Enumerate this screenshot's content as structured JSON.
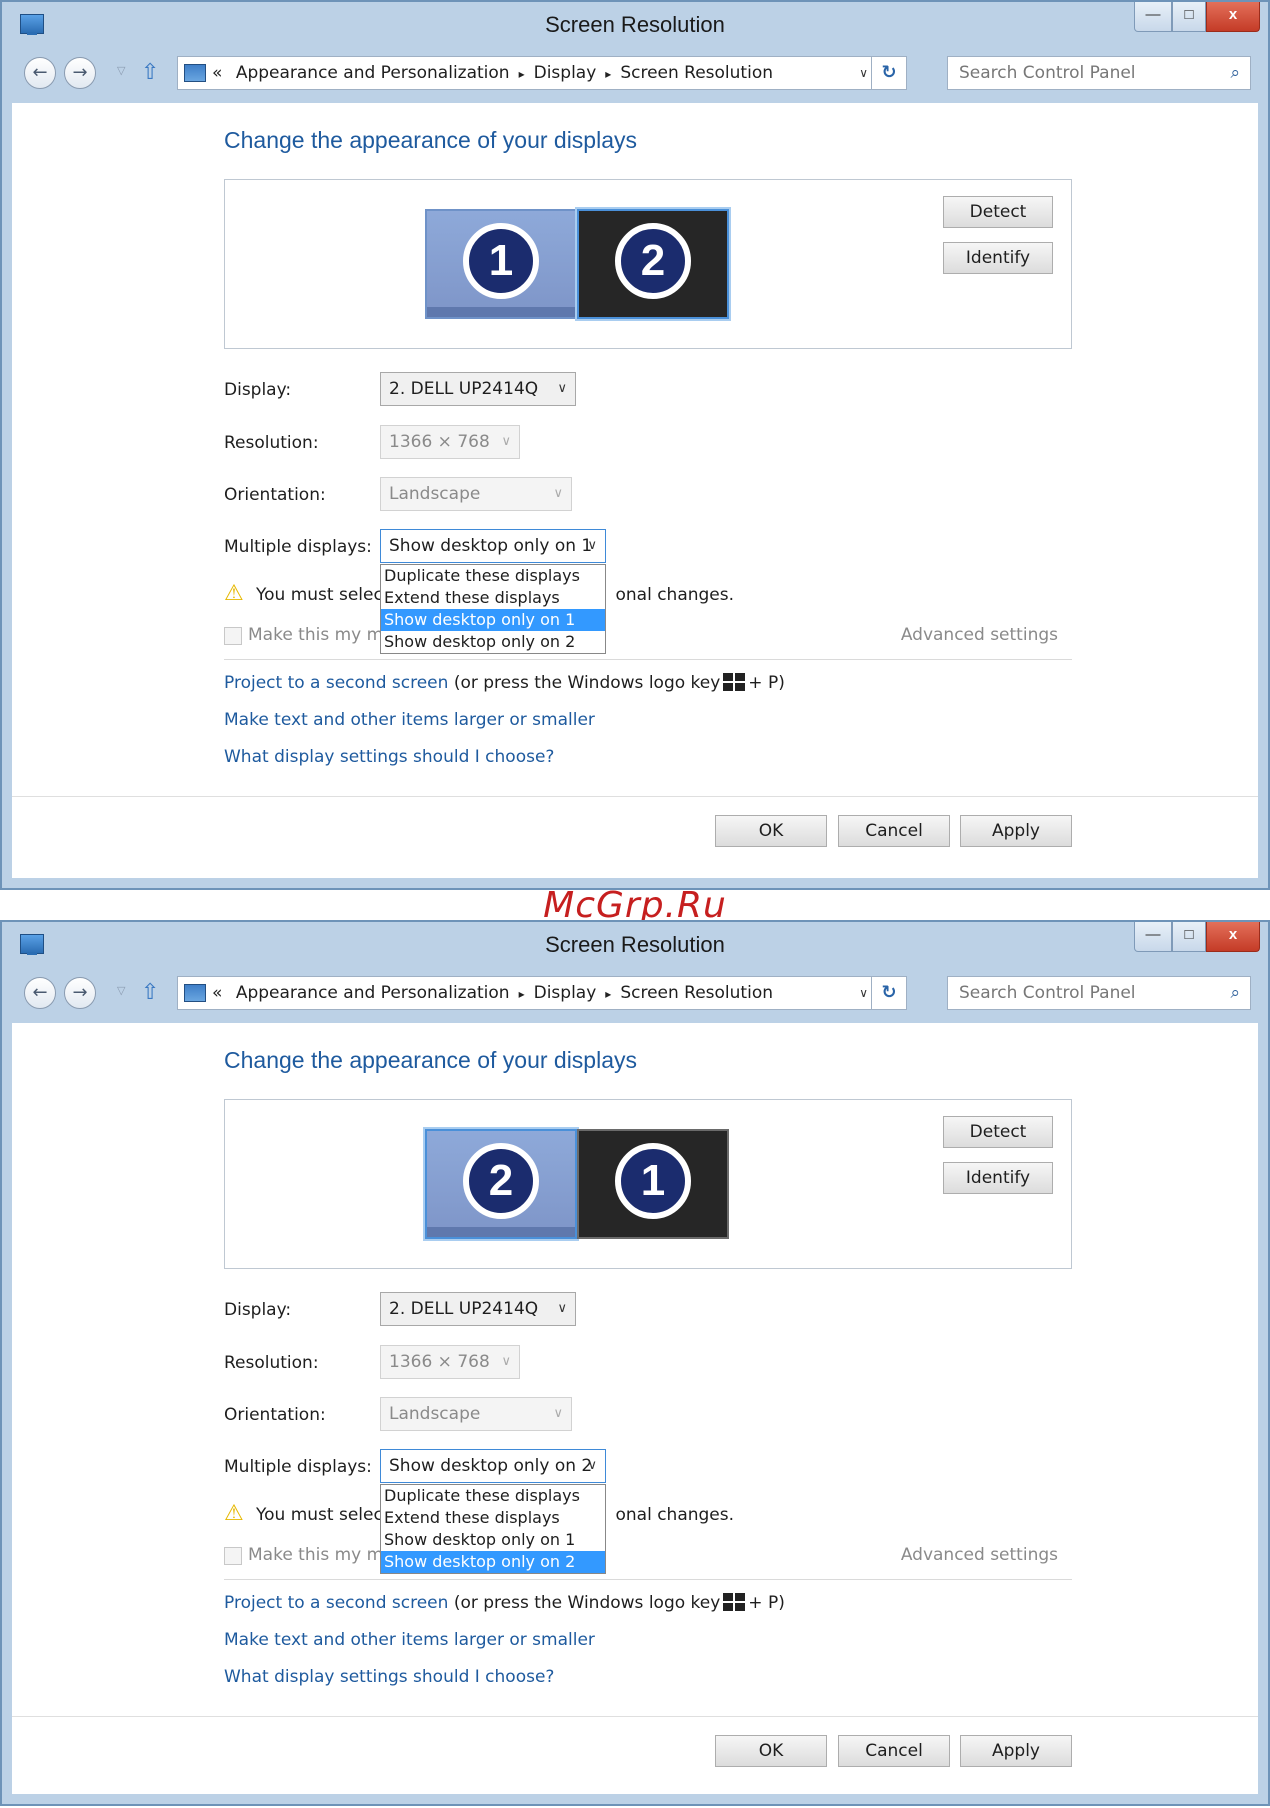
{
  "window_title": "Screen Resolution",
  "window_controls": {
    "minimize": "—",
    "maximize": "□",
    "close": "x"
  },
  "nav": {
    "back": "←",
    "forward": "→",
    "up": "⇧",
    "recent": "▽"
  },
  "address": {
    "prefix": "«",
    "crumbs": [
      "Appearance and Personalization",
      "Display",
      "Screen Resolution"
    ],
    "separator": "▸",
    "dropdown": "∨",
    "refresh": "↻"
  },
  "search": {
    "placeholder": "Search Control Panel",
    "icon": "⌕"
  },
  "heading": "Change the appearance of your displays",
  "buttons": {
    "detect": "Detect",
    "identify": "Identify",
    "ok": "OK",
    "cancel": "Cancel",
    "apply": "Apply"
  },
  "labels": {
    "display": "Display:",
    "resolution": "Resolution:",
    "orientation": "Orientation:",
    "multiple": "Multiple displays:"
  },
  "values": {
    "display": "2. DELL UP2414Q",
    "resolution": "1366 × 768",
    "orientation": "Landscape"
  },
  "warning": {
    "before": "You must select",
    "after": "onal changes."
  },
  "checkbox_label_visible": "Make this my ma",
  "advanced": "Advanced settings",
  "links": {
    "project": "Project to a second screen",
    "project_note_before": "(or press the Windows logo key",
    "project_note_after": "+ P)",
    "text_size": "Make text and other items larger or smaller",
    "what": "What display settings should I choose?"
  },
  "dropdown_options": [
    "Duplicate these displays",
    "Extend these displays",
    "Show desktop only on 1",
    "Show desktop only on 2"
  ],
  "screens": [
    {
      "monitors": [
        {
          "number": "1",
          "selected": false,
          "style": "blue"
        },
        {
          "number": "2",
          "selected": true,
          "style": "dark"
        }
      ],
      "multiple_value": "Show desktop only on 1",
      "highlighted_index": 2
    },
    {
      "monitors": [
        {
          "number": "2",
          "selected": true,
          "style": "blue"
        },
        {
          "number": "1",
          "selected": false,
          "style": "dark"
        }
      ],
      "multiple_value": "Show desktop only on 2",
      "highlighted_index": 3
    }
  ],
  "watermark": "McGrp.Ru",
  "colors": {
    "link": "#1e5a9e",
    "highlight": "#3399ff",
    "frame": "#bcd1e6",
    "warning": "#e6b800",
    "watermark": "#c61f1f"
  }
}
